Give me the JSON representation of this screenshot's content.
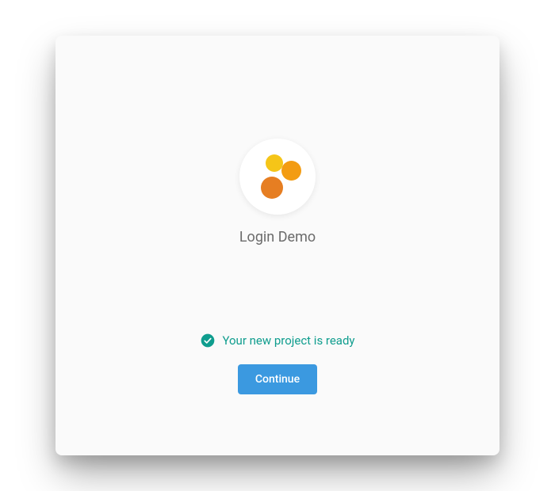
{
  "app": {
    "title": "Login Demo"
  },
  "status": {
    "message": "Your new project is ready"
  },
  "actions": {
    "continue_label": "Continue"
  },
  "colors": {
    "accent": "#3B99E0",
    "success": "#0F9D8E",
    "logo_yellow": "#F5C518",
    "logo_orange": "#F39C12",
    "logo_darkorange": "#E67E22"
  }
}
